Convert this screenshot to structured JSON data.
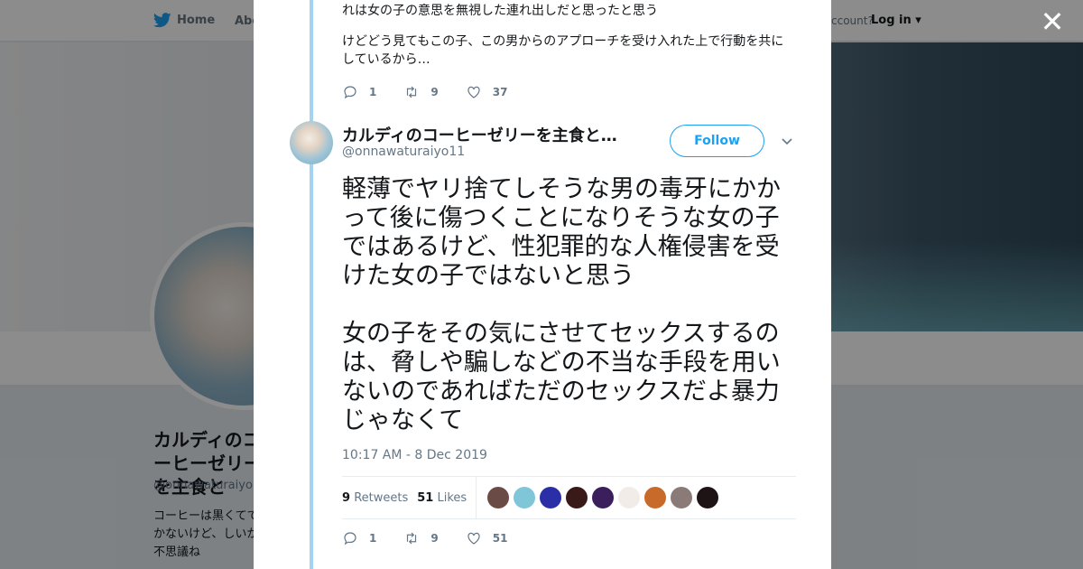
{
  "nav": {
    "home_label": "Home",
    "about_label": "Abo",
    "account_prompt": "ccount?",
    "login_label": "Log in"
  },
  "profile": {
    "name": "カルディのコーヒーゼリーを主食と",
    "handle": "@onnawaturaiyo1",
    "bio": "コーヒーは黒くてでしかないけど、しいから不思議ね"
  },
  "previous_tweet": {
    "text_lines": [
      "れは女の子の意思を無視した連れ出しだと思ったと思う",
      "けどどう見てもこの子、この男からのアプローチを受け入れた上で行動を共にしているから…"
    ],
    "replies": "1",
    "retweets": "9",
    "likes": "37"
  },
  "tweet": {
    "author_name": "カルディのコーヒーゼリーを主食と…",
    "author_handle": "@onnawaturaiyo11",
    "follow_label": "Follow",
    "paragraphs": [
      "軽薄でヤリ捨てしそうな男の毒牙にかかって後に傷つくことになりそうな女の子ではあるけど、性犯罪的な人権侵害を受けた女の子ではないと思う",
      "女の子をその気にさせてセックスするのは、脅しや騙しなどの不当な手段を用いないのであればただのセックスだよ暴力じゃなくて"
    ],
    "timestamp": "10:17 AM - 8 Dec 2019",
    "retweet_count": "9",
    "retweet_label": "Retweets",
    "like_count": "51",
    "like_label": "Likes",
    "replies": "1",
    "retweets": "9",
    "likes": "51"
  },
  "likers": [
    {
      "color": "#6b4b45"
    },
    {
      "color": "#7fc6d9"
    },
    {
      "color": "#2a2fa8"
    },
    {
      "color": "#3a1a18"
    },
    {
      "color": "#3b1e5c"
    },
    {
      "color": "#f2ece8"
    },
    {
      "color": "#c86a2a"
    },
    {
      "color": "#8a7b78"
    },
    {
      "color": "#1e1416"
    }
  ],
  "colors": {
    "accent": "#1da1f2",
    "thread_line": "#a3d3f3",
    "text_primary": "#14171a",
    "text_secondary": "#657786"
  }
}
